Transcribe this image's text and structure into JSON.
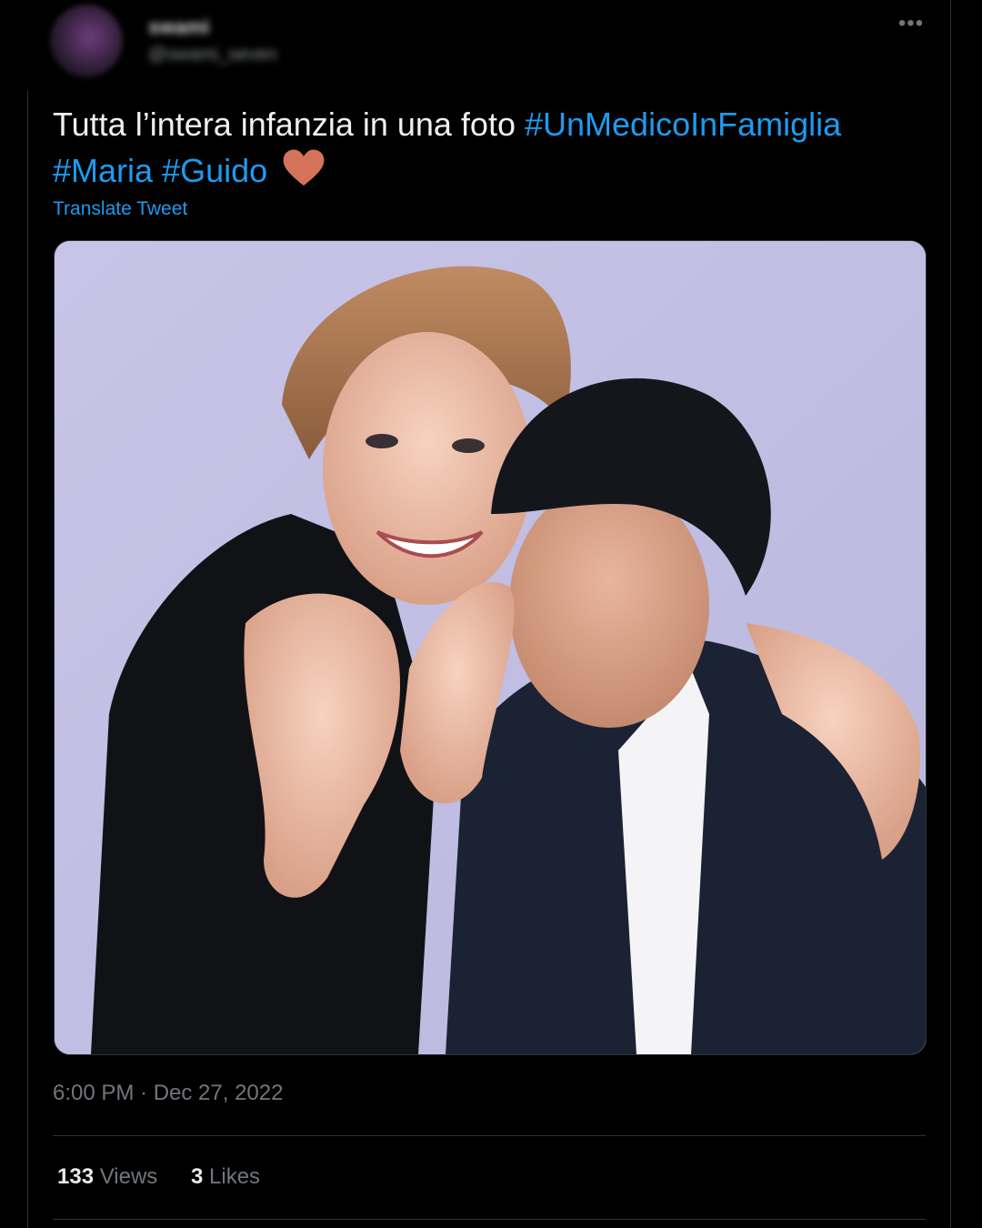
{
  "author": {
    "name": "swami",
    "handle": "@swami_seven"
  },
  "tweet": {
    "text": "Tutta l’intera infanzia in una foto",
    "hashtags": [
      "#UnMedicoInFamiglia",
      "#Maria",
      "#Guido"
    ],
    "emoji_icon": "orange-heart-icon",
    "translate_label": "Translate Tweet",
    "timestamp": "6:00 PM · Dec 27, 2022"
  },
  "media": {
    "alt": "Photo"
  },
  "stats": {
    "views_count": "133",
    "views_label": "Views",
    "likes_count": "3",
    "likes_label": "Likes"
  },
  "colors": {
    "background": "#000000",
    "link": "#1d9bf0",
    "heart": "#d4735a",
    "muted": "#71767b"
  }
}
